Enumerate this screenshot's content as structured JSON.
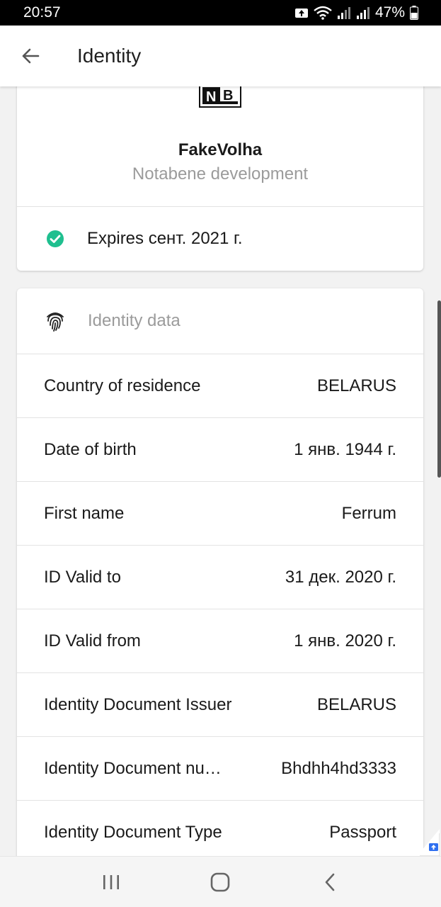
{
  "status_bar": {
    "time": "20:57",
    "battery": "47%"
  },
  "app_bar": {
    "title": "Identity",
    "back_icon": "arrow-back-icon"
  },
  "organization": {
    "logo_text": "NB",
    "name": "FakeVolha",
    "subtitle": "Notabene development",
    "expiry": "Expires сент. 2021 г.",
    "expiry_status_color": "#1fbf8f"
  },
  "identity_data": {
    "header": "Identity data",
    "rows": [
      {
        "label": "Country of residence",
        "value": "BELARUS"
      },
      {
        "label": "Date of birth",
        "value": "1 янв. 1944 г."
      },
      {
        "label": "First name",
        "value": "Ferrum"
      },
      {
        "label": "ID Valid to",
        "value": "31 дек. 2020 г."
      },
      {
        "label": "ID Valid from",
        "value": "1 янв. 2020 г."
      },
      {
        "label": "Identity Document Issuer",
        "value": "BELARUS"
      },
      {
        "label": "Identity Document nu…",
        "value": "Bhdhh4hd3333"
      },
      {
        "label": "Identity Document Type",
        "value": "Passport"
      }
    ]
  },
  "colors": {
    "accent_check": "#1fbf8f",
    "badge": "#2f6ff0"
  }
}
